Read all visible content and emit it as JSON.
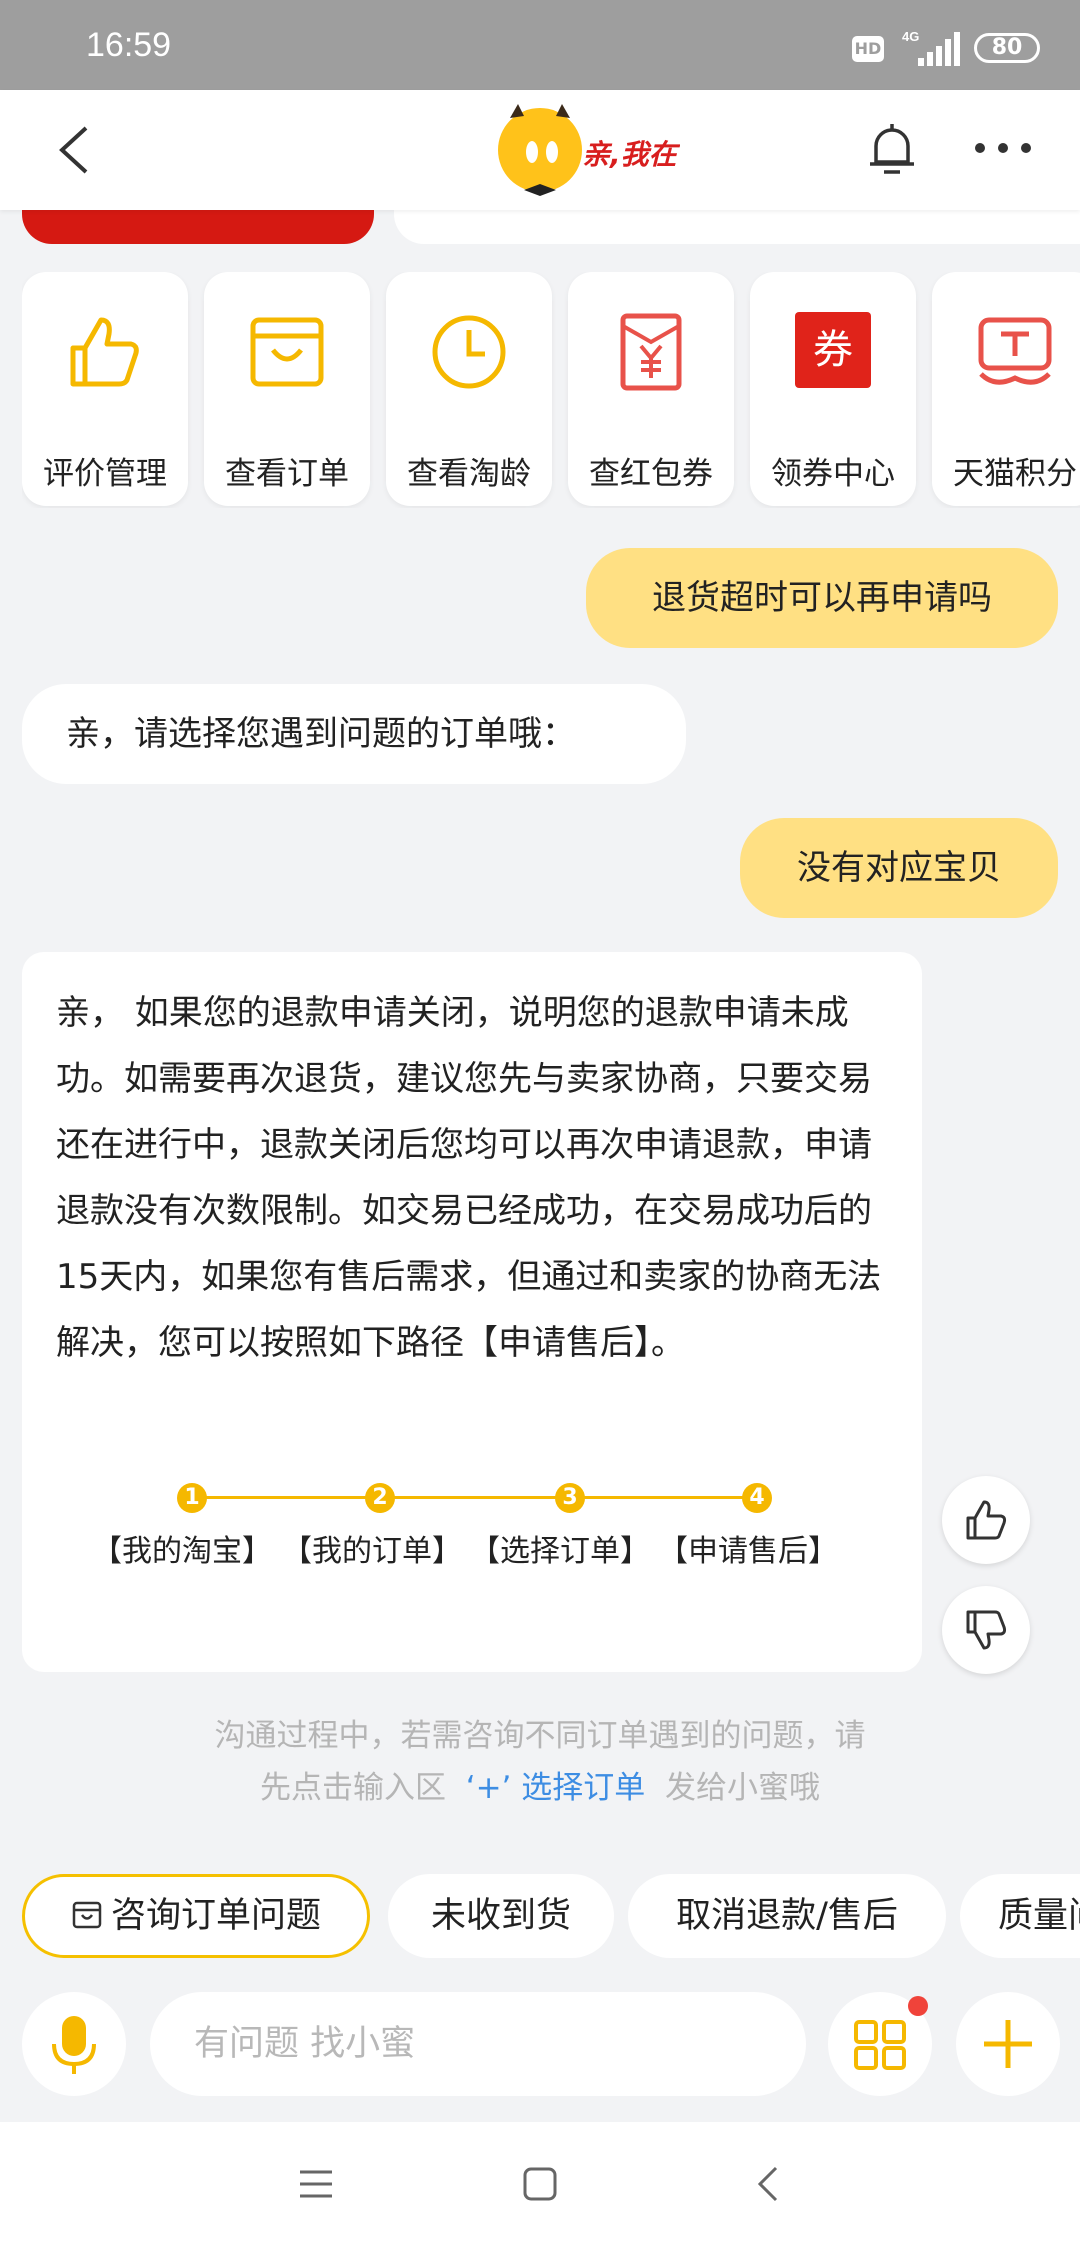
{
  "status_bar": {
    "time": "16:59",
    "hd_label": "HD",
    "network": "4G",
    "battery": "80"
  },
  "header": {
    "logo_text": "亲,我在",
    "back_icon": "back-arrow-icon",
    "bell_icon": "bell-icon",
    "more_icon": "more-icon"
  },
  "tools": [
    {
      "label": "评价管理",
      "icon": "thumbs-up-icon"
    },
    {
      "label": "查看订单",
      "icon": "shopping-bag-icon"
    },
    {
      "label": "查看淘龄",
      "icon": "clock-icon"
    },
    {
      "label": "查红包券",
      "icon": "red-envelope-icon"
    },
    {
      "label": "领券中心",
      "icon": "coupon-icon",
      "icon_text": "券"
    },
    {
      "label": "天猫积分",
      "icon": "tmall-icon"
    }
  ],
  "messages": {
    "user_1": "退货超时可以再申请吗",
    "bot_1": "亲，请选择您遇到问题的订单哦：",
    "user_2": "没有对应宝贝",
    "bot_2": "亲， 如果您的退款申请关闭，说明您的退款申请未成功。如需要再次退货，建议您先与卖家协商，只要交易还在进行中，退款关闭后您均可以再次申请退款，申请退款没有次数限制。如交易已经成功，在交易成功后的15天内，如果您有售后需求，但通过和卖家的协商无法解决，您可以按照如下路径【申请售后】。",
    "flow_steps": [
      {
        "num": "1",
        "label": "【我的淘宝】"
      },
      {
        "num": "2",
        "label": "【我的订单】"
      },
      {
        "num": "3",
        "label": "【选择订单】"
      },
      {
        "num": "4",
        "label": "【申请售后】"
      }
    ]
  },
  "notice": {
    "line1": "沟通过程中，若需咨询不同订单遇到的问题，请",
    "line2_a": "先点击输入区",
    "line2_plus": "‘+’",
    "line2_link": "选择订单",
    "line2_b": "发给小蜜哦"
  },
  "quick_chips": [
    "咨询订单问题",
    "未收到货",
    "取消退款/售后",
    "质量问题"
  ],
  "input": {
    "placeholder": "有问题 找小蜜"
  },
  "colors": {
    "accent": "#f5b800",
    "bubble": "#ffe083",
    "link": "#3d8de3",
    "coupon_red": "#e0231a"
  }
}
